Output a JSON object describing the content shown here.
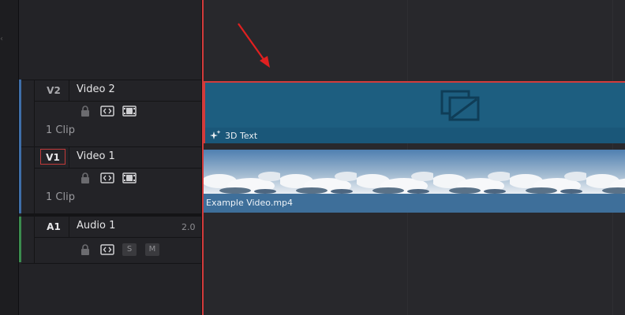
{
  "tracks": [
    {
      "id": "V2",
      "name": "Video 2",
      "clip_count": "1 Clip",
      "color": "#3f6ea8",
      "selected": false
    },
    {
      "id": "V1",
      "name": "Video 1",
      "clip_count": "1 Clip",
      "color": "#3f6ea8",
      "selected": true
    },
    {
      "id": "A1",
      "name": "Audio 1",
      "level": "2.0",
      "color": "#3b8c4e",
      "selected": false
    }
  ],
  "audio_buttons": {
    "solo": "S",
    "mute": "M"
  },
  "clips": {
    "v2": {
      "label": "3D Text",
      "color": "#1d5e80"
    },
    "v1": {
      "label": "Example Video.mp4",
      "color": "#3e6f9a"
    }
  },
  "colors": {
    "playhead": "#d33a3a",
    "annotation": "#e02020"
  }
}
